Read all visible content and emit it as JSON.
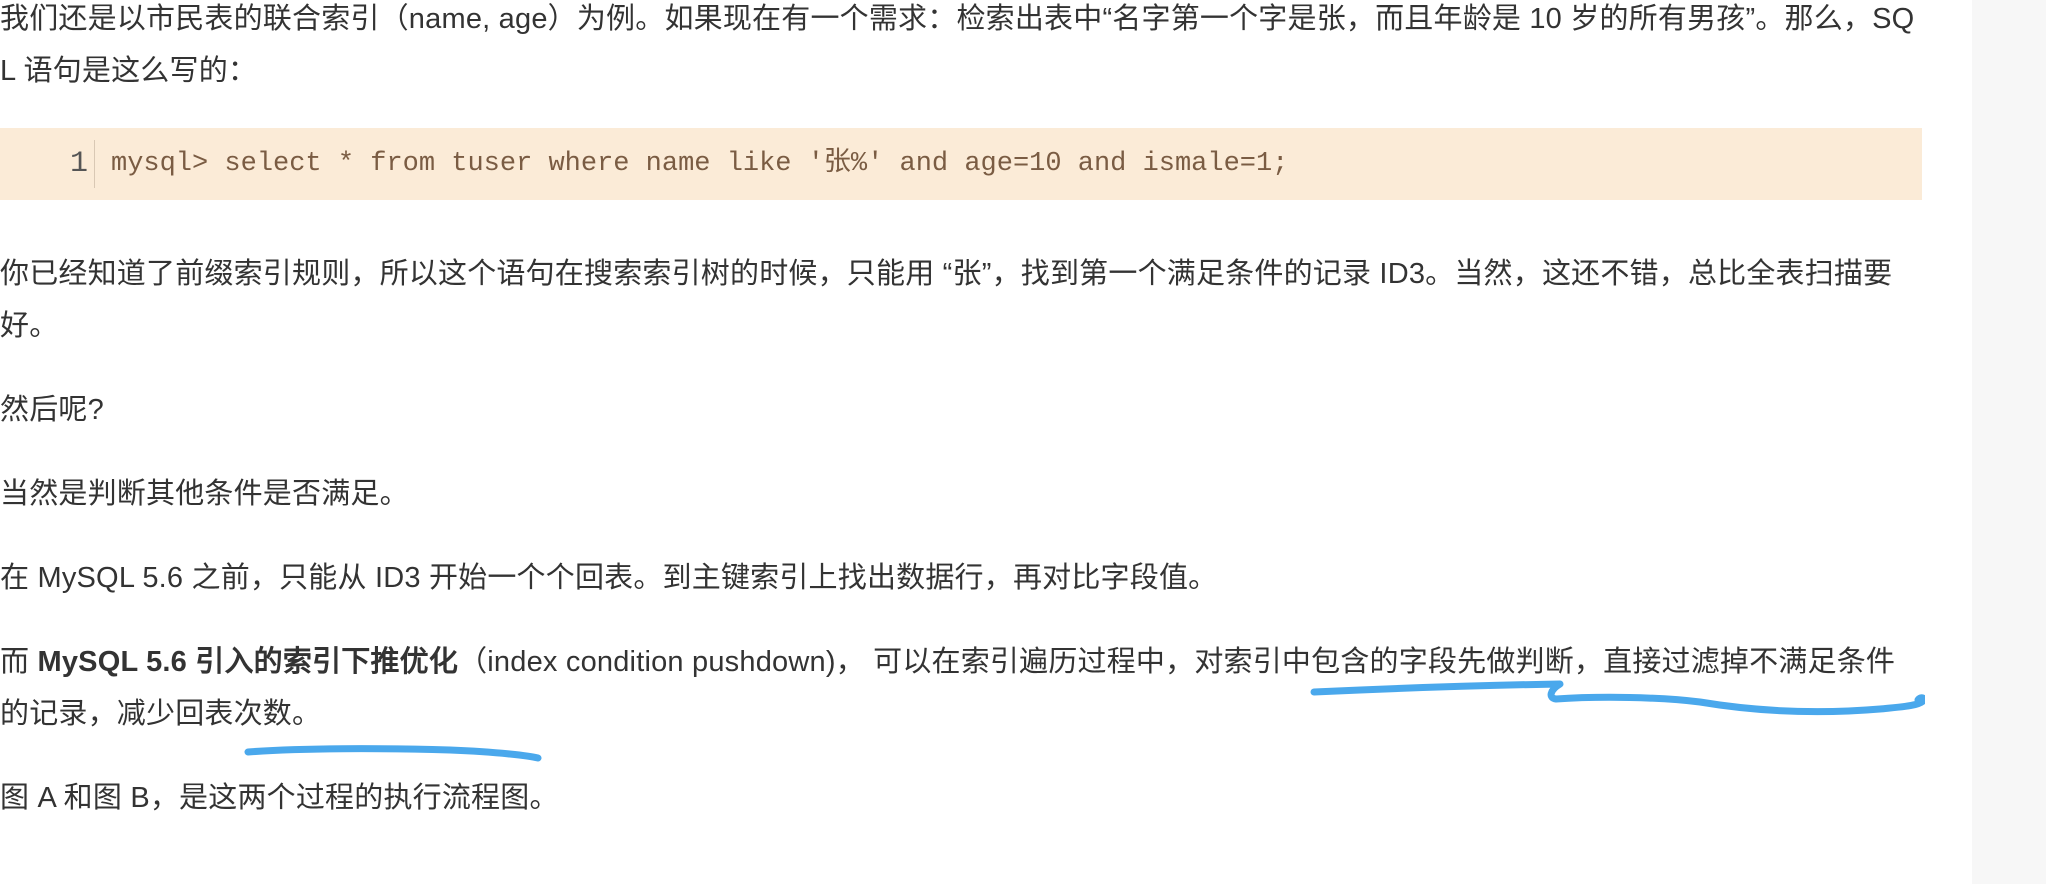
{
  "paragraphs": {
    "p1": "我们还是以市民表的联合索引（name, age）为例。如果现在有一个需求：检索出表中“名字第一个字是张，而且年龄是 10 岁的所有男孩”。那么，SQL 语句是这么写的：",
    "p2": "你已经知道了前缀索引规则，所以这个语句在搜索索引树的时候，只能用 “张”，找到第一个满足条件的记录 ID3。当然，这还不错，总比全表扫描要好。",
    "p3": "然后呢?",
    "p4": "当然是判断其他条件是否满足。",
    "p5": "在 MySQL 5.6 之前，只能从 ID3 开始一个个回表。到主键索引上找出数据行，再对比字段值。",
    "p6": {
      "lead": "而 ",
      "bold": "MySQL 5.6 引入的索引下推优化",
      "rest": "（index condition pushdown)， 可以在索引遍历过程中，对索引中包含的字段先做判断，直接过滤掉不满足条件的记录，减少回表次数。"
    },
    "p7": "图 A 和图 B，是这两个过程的执行流程图。"
  },
  "code": {
    "line_number": "1",
    "text": "mysql> select * from tuser where name like '张%' and age=10 and ismale=1;"
  },
  "annotation": {
    "color": "#4aa8ec"
  }
}
